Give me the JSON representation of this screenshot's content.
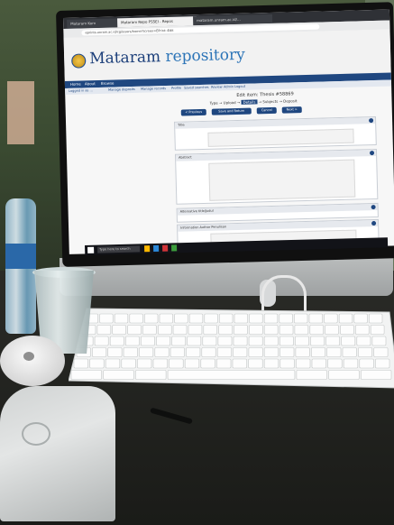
{
  "browser": {
    "tabs": [
      "Mataram Kom",
      "Mataram Repo PSSEI - Repos",
      "mataram.unram.ac.id/..."
    ],
    "url": "eprints.unram.ac.id/cgi/users/home?screen=EPrint::Edit"
  },
  "site": {
    "title_part1": "Mataram",
    "title_part2": " repository",
    "nav": [
      "Home",
      "About",
      "Browse"
    ],
    "subnav": [
      "Logged in as ...",
      "Manage deposits",
      "Manage records",
      "Profile",
      "Saved searches",
      "Review",
      "Admin",
      "Logout"
    ]
  },
  "form": {
    "title": "Edit item: Thesis #58869",
    "stages": [
      "Type",
      "Upload",
      "Details",
      "Subjects",
      "Deposit"
    ],
    "current_stage": "Details",
    "buttons": [
      "< Previous",
      "Save and Return",
      "Cancel",
      "Next >"
    ],
    "panels": [
      "Title",
      "Abstract",
      "Alternative title/Judul",
      "Information Author Penulisan"
    ]
  },
  "taskbar": {
    "search_placeholder": "Type here to search"
  },
  "colors": {
    "brand_blue": "#1f4780",
    "wall_green": "#3a4a31",
    "monitor_body": "#b9bcbc",
    "keyboard": "#f2f3f3"
  }
}
